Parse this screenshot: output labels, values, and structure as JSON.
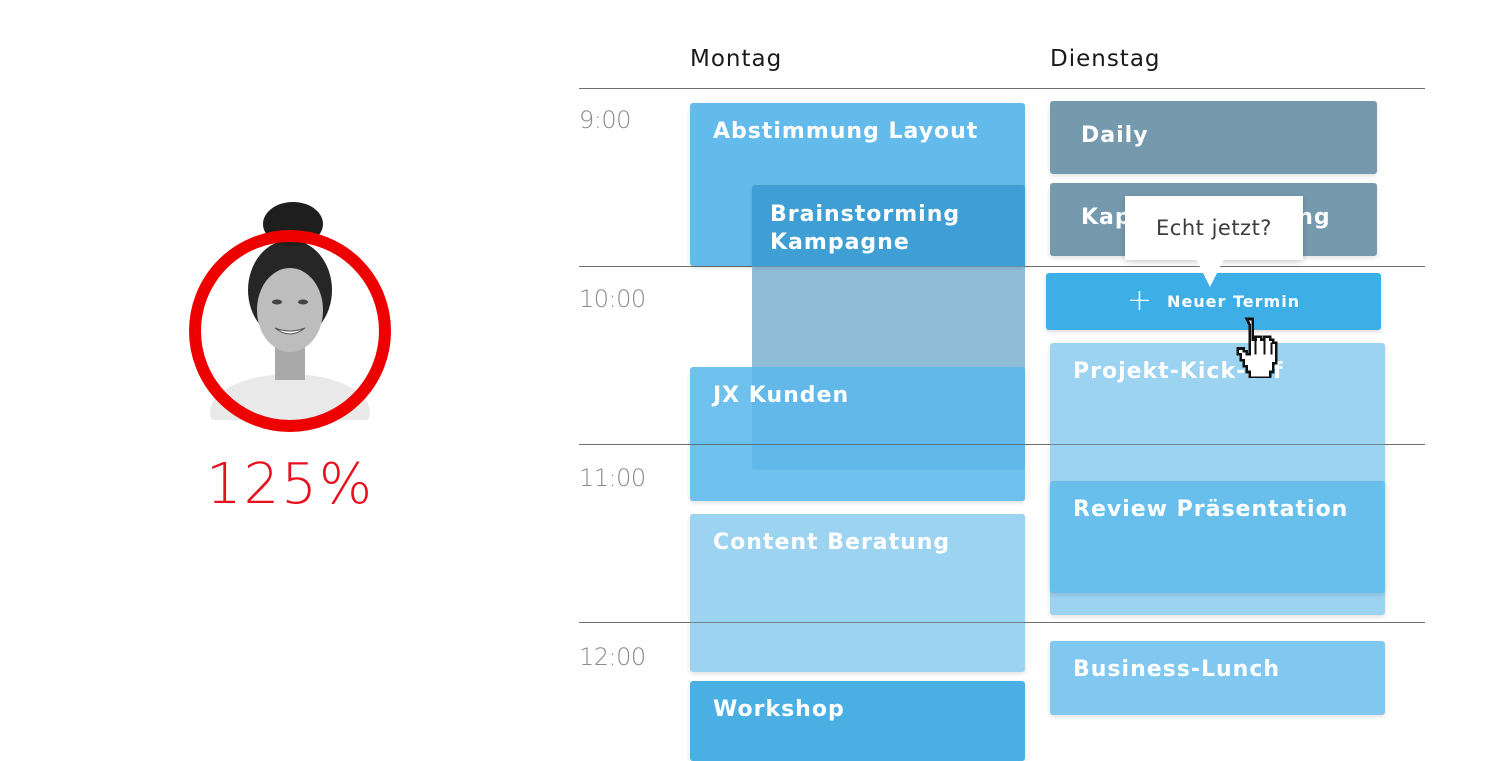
{
  "profile": {
    "utilization": "125%",
    "ring_color": "#ee0000",
    "avatar_alt": "woman portrait"
  },
  "calendar": {
    "days": [
      "Montag",
      "Dienstag"
    ],
    "times": [
      "9:00",
      "10:00",
      "11:00",
      "12:00"
    ],
    "events_monday": [
      {
        "title": "Abstimmung Layout"
      },
      {
        "title": "Brainstorming Kampagne"
      },
      {
        "title": "JX Kunden"
      },
      {
        "title": "Content Beratung"
      },
      {
        "title": "Workshop"
      }
    ],
    "events_tuesday": [
      {
        "title": "Daily"
      },
      {
        "title": "Kapazitätsplanung"
      },
      {
        "title": "Projekt-Kick-off"
      },
      {
        "title": "Review Präsentation"
      },
      {
        "title": "Business-Lunch"
      }
    ],
    "new_button": {
      "label": "Neuer Termin",
      "icon": "plus-icon"
    },
    "tooltip": "Echt jetzt?"
  },
  "colors": {
    "accent": "#3daee6",
    "event_grey": "#7599ad",
    "event_light": "#9bd3f1",
    "danger": "#e8101e"
  }
}
